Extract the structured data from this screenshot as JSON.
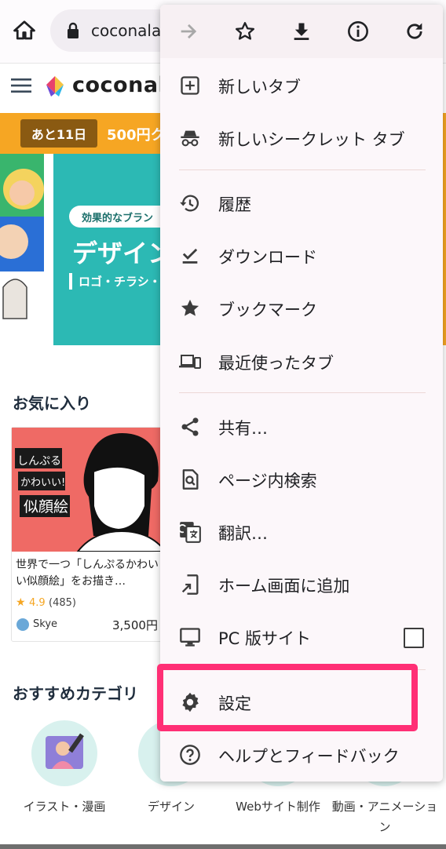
{
  "browser": {
    "url": "coconala"
  },
  "site": {
    "logo_text": "coconala",
    "promo_badge": "あと11日",
    "promo_text": "500円ク",
    "banner_pill": "効果的なブラン",
    "banner_title": "デザイン",
    "banner_subtitle": "ロゴ・チラシ・"
  },
  "favorites": {
    "heading": "お気に入り",
    "card": {
      "thumb_text_1": "しんぷる",
      "thumb_text_2": "かわいい!",
      "thumb_text_3": "似顔絵",
      "title": "世界で一つ「しんぷるかわいい似顔絵」をお描き…",
      "rating": "4.9",
      "review_count": "(485)",
      "seller": "Skye",
      "price": "3,500円"
    }
  },
  "categories": {
    "heading": "おすすめカテゴリ",
    "items": [
      {
        "label": "イラスト・漫画"
      },
      {
        "label": "デザイン"
      },
      {
        "label": "Webサイト制作"
      },
      {
        "label": "動画・アニメーション"
      }
    ]
  },
  "menu": {
    "toolbar": [
      "forward-icon",
      "star-icon",
      "download-icon",
      "info-icon",
      "refresh-icon"
    ],
    "items": [
      {
        "label": "新しいタブ",
        "icon": "new-tab-icon"
      },
      {
        "label": "新しいシークレット タブ",
        "icon": "incognito-icon"
      },
      {
        "label": "履歴",
        "icon": "history-icon"
      },
      {
        "label": "ダウンロード",
        "icon": "downloads-icon"
      },
      {
        "label": "ブックマーク",
        "icon": "bookmarks-icon"
      },
      {
        "label": "最近使ったタブ",
        "icon": "recent-tabs-icon"
      },
      {
        "label": "共有…",
        "icon": "share-icon"
      },
      {
        "label": "ページ内検索",
        "icon": "find-in-page-icon"
      },
      {
        "label": "翻訳…",
        "icon": "translate-icon"
      },
      {
        "label": "ホーム画面に追加",
        "icon": "add-to-home-icon"
      },
      {
        "label": "PC 版サイト",
        "icon": "desktop-icon",
        "checked": false
      },
      {
        "label": "設定",
        "icon": "settings-icon",
        "highlighted": true
      },
      {
        "label": "ヘルプとフィードバック",
        "icon": "help-icon"
      }
    ]
  },
  "colors": {
    "highlight": "#ff2f75",
    "promo": "#f6a623",
    "banner": "#2cb9b4",
    "menu_bg": "#fcf7fa"
  }
}
